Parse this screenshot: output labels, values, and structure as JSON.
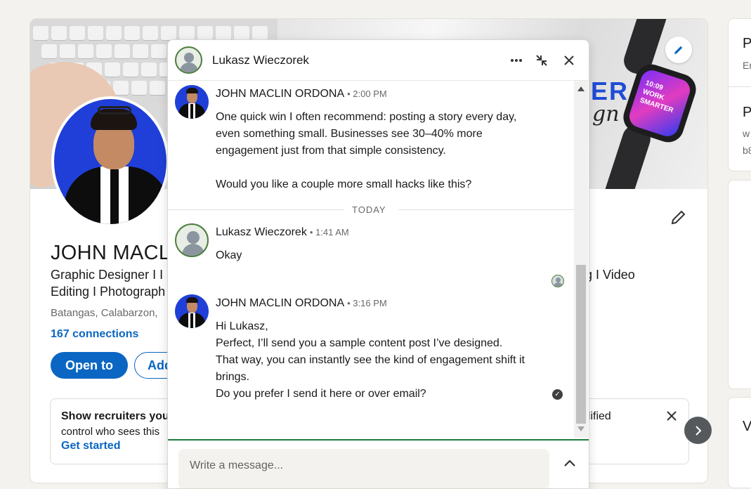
{
  "profile": {
    "name": "JOHN MACLI",
    "headline_left": "Graphic Designer I I\nEditing I Photograph",
    "headline_right": "g I Video",
    "location": "Batangas, Calabarzon,",
    "connections": "167 connections",
    "open_to_label": "Open to",
    "add_label": "Add",
    "recruiter_title": "Show recruiters you'",
    "recruiter_body": "control who sees this",
    "recruiter_link": "Get started",
    "recruiter_right": "alified",
    "banner_text": "ER",
    "banner_script": "gn",
    "watch_text": "10:09\nWORK\nSMARTER"
  },
  "right_rail": {
    "item1_title": "P",
    "item1_sub": "Er",
    "item2_title": "P",
    "item2_sub1": "w",
    "item2_sub2": "b8",
    "item3_title": "V"
  },
  "chat": {
    "title": "Lukasz Wieczorek",
    "messages": [
      {
        "sender": "JOHN MACLIN ORDONA",
        "time": "• 2:00 PM",
        "text": "One quick win I often recommend: posting a story every day, even something small. Businesses see 30–40% more engagement just from that simple consistency.\n\nWould you like a couple more small hacks like this?"
      },
      {
        "sender": "Lukasz Wieczorek",
        "time": "• 1:41 AM",
        "text": "Okay"
      },
      {
        "sender": "JOHN MACLIN ORDONA",
        "time": "• 3:16 PM",
        "text": "Hi Lukasz,\nPerfect, I’ll send you a sample content post I’ve designed.\nThat way, you can instantly see the kind of engagement shift it brings.\nDo you prefer I send it here or over email?"
      }
    ],
    "day_divider": "TODAY",
    "composer_placeholder": "Write a message..."
  },
  "icons": {
    "more": "more-icon",
    "minimize": "minimize-icon",
    "close": "close-icon",
    "pencil": "pencil-icon",
    "chevron_up": "chevron-up-icon",
    "chevron_right": "chevron-right-icon"
  },
  "colors": {
    "brand_blue": "#0a66c2",
    "composer_focus_green": "#1a7d3d"
  }
}
